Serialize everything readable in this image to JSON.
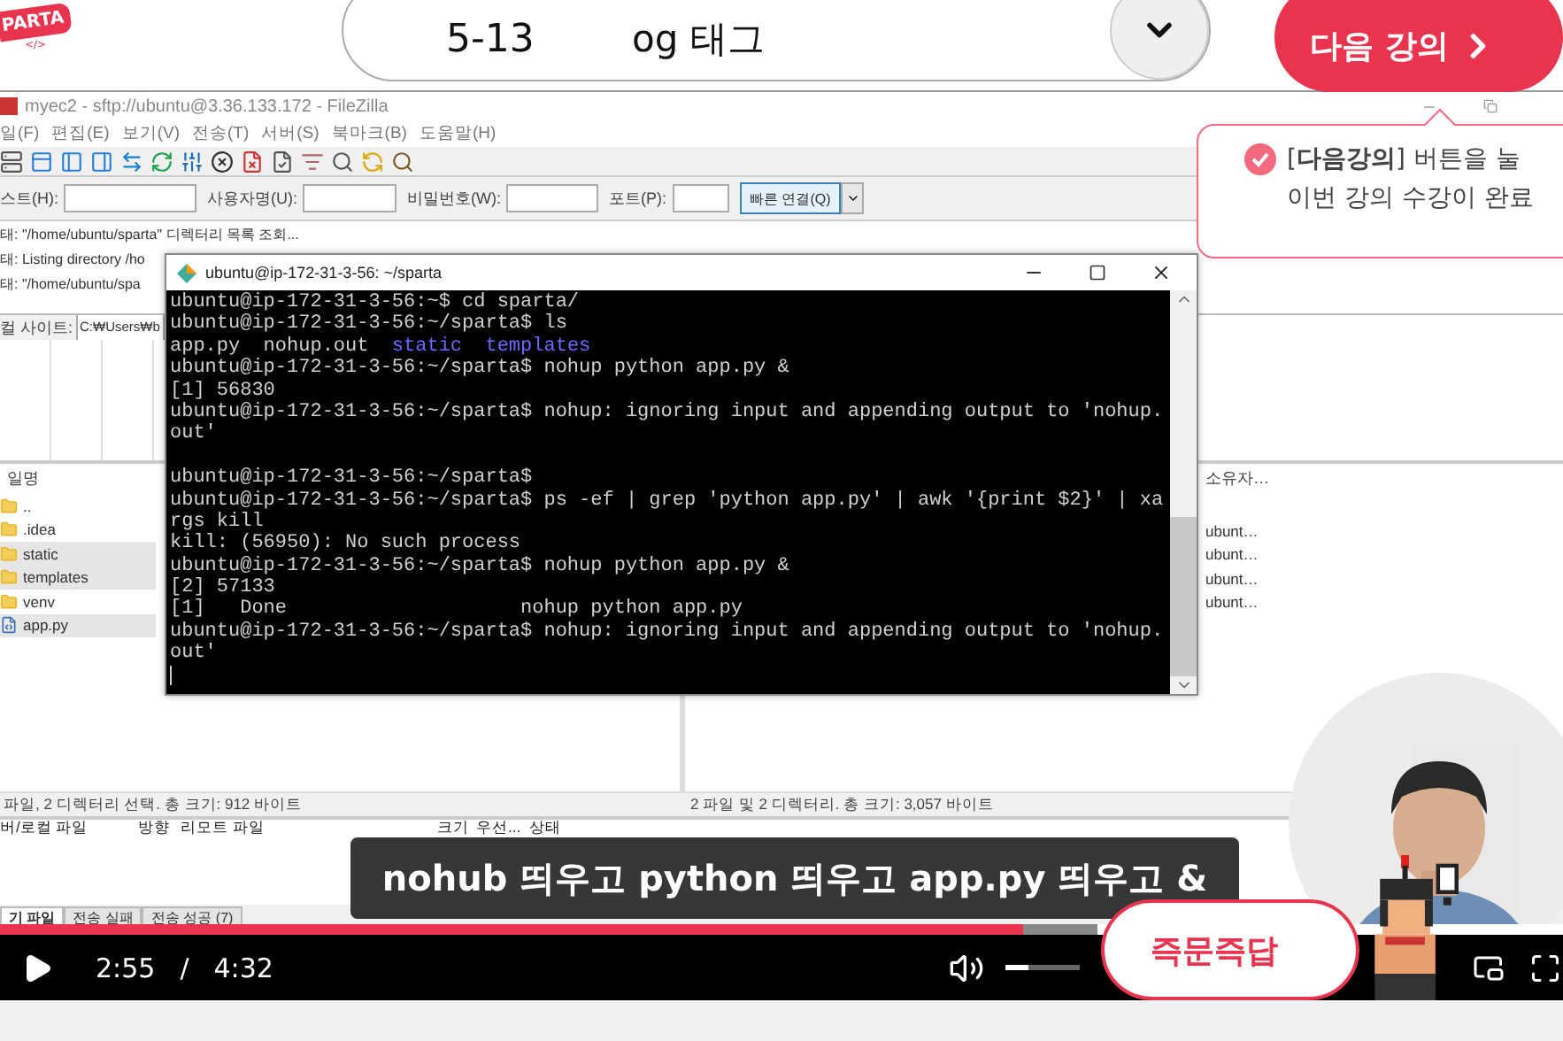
{
  "header": {
    "logo": {
      "text": "PARTA",
      "subtext": "</>"
    },
    "lesson": {
      "number": "5-13",
      "title": "og 태그"
    },
    "next_button": {
      "label": "다음 강의"
    }
  },
  "tooltip": {
    "lines": [
      "[**다음강의**] 버튼을 눌",
      "이번 강의 수강이 완료"
    ]
  },
  "filezilla": {
    "title": "myec2 - sftp://ubuntu@3.36.133.172 - FileZilla",
    "menu": [
      "일(F)",
      "편집(E)",
      "보기(V)",
      "전송(T)",
      "서버(S)",
      "북마크(B)",
      "도움말(H)"
    ],
    "quickconnect": {
      "fields": [
        {
          "label": "스트(H):"
        },
        {
          "label": "사용자명(U):"
        },
        {
          "label": "비밀번호(W):"
        },
        {
          "label": "포트(P):"
        }
      ],
      "button": "빠른 연결(Q)"
    },
    "log": [
      {
        "label": "태:",
        "text": "\"/home/ubuntu/sparta\" 디렉터리 목록 조회..."
      },
      {
        "label": "태:",
        "text": "Listing directory /ho"
      },
      {
        "label": "태:",
        "text": "\"/home/ubuntu/spa"
      }
    ],
    "local_site": {
      "label": "컬 사이트:",
      "value": "C:₩Users₩b"
    },
    "local_files": {
      "header": "일명",
      "rows": [
        {
          "name": "..",
          "kind": "folder",
          "selected": false
        },
        {
          "name": ".idea",
          "kind": "folder",
          "selected": false
        },
        {
          "name": "static",
          "kind": "folder",
          "selected": true
        },
        {
          "name": "templates",
          "kind": "folder",
          "selected": true
        },
        {
          "name": "venv",
          "kind": "folder",
          "selected": false
        },
        {
          "name": "app.py",
          "kind": "python",
          "selected": true
        }
      ]
    },
    "remote_files": {
      "column": "소유자…",
      "rows": [
        "ubunt…",
        "ubunt…",
        "ubunt…",
        "ubunt…"
      ]
    },
    "local_status": "파일, 2 디렉터리 선택. 총 크기: 912 바이트",
    "remote_status": "2 파일 및 2 디렉터리. 총 크기: 3,057 바이트",
    "queue": {
      "columns": [
        "버/로컬 파일",
        "방향",
        "리모트 파일",
        "크기",
        "우선...",
        "상태"
      ]
    },
    "queue_tabs": [
      {
        "label": "기 파일",
        "selected": true
      },
      {
        "label": "전송 실패",
        "selected": false
      },
      {
        "label": "전송 성공 (7)",
        "selected": false
      }
    ]
  },
  "terminal": {
    "title": "ubuntu@ip-172-31-3-56: ~/sparta",
    "lines": [
      {
        "kind": "text",
        "segments": [
          {
            "kind": "plain",
            "text": "ubuntu@ip-172-31-3-56:~$ cd sparta/"
          }
        ]
      },
      {
        "kind": "text",
        "segments": [
          {
            "kind": "plain",
            "text": "ubuntu@ip-172-31-3-56:~/sparta$ ls"
          }
        ]
      },
      {
        "kind": "text",
        "segments": [
          {
            "kind": "plain",
            "text": "app.py  nohup.out  "
          },
          {
            "kind": "dir",
            "text": "static  "
          },
          {
            "kind": "dir",
            "text": "templates"
          }
        ]
      },
      {
        "kind": "text",
        "segments": [
          {
            "kind": "plain",
            "text": "ubuntu@ip-172-31-3-56:~/sparta$ nohup python app.py &"
          }
        ]
      },
      {
        "kind": "text",
        "segments": [
          {
            "kind": "plain",
            "text": "[1] 56830"
          }
        ]
      },
      {
        "kind": "text",
        "segments": [
          {
            "kind": "plain",
            "text": "ubuntu@ip-172-31-3-56:~/sparta$ nohup: ignoring input and appending output to 'nohup."
          }
        ]
      },
      {
        "kind": "text",
        "segments": [
          {
            "kind": "plain",
            "text": "out'"
          }
        ]
      },
      {
        "kind": "blank"
      },
      {
        "kind": "text",
        "segments": [
          {
            "kind": "plain",
            "text": "ubuntu@ip-172-31-3-56:~/sparta$"
          }
        ]
      },
      {
        "kind": "text",
        "segments": [
          {
            "kind": "plain",
            "text": "ubuntu@ip-172-31-3-56:~/sparta$ ps -ef | grep 'python app.py' | awk '{print $2}' | xa"
          }
        ]
      },
      {
        "kind": "text",
        "segments": [
          {
            "kind": "plain",
            "text": "rgs kill"
          }
        ]
      },
      {
        "kind": "text",
        "segments": [
          {
            "kind": "plain",
            "text": "kill: (56950): No such process"
          }
        ]
      },
      {
        "kind": "text",
        "segments": [
          {
            "kind": "plain",
            "text": "ubuntu@ip-172-31-3-56:~/sparta$ nohup python app.py &"
          }
        ]
      },
      {
        "kind": "text",
        "segments": [
          {
            "kind": "plain",
            "text": "[2] 57133"
          }
        ]
      },
      {
        "kind": "text",
        "segments": [
          {
            "kind": "plain",
            "text": "[1]   Done                    nohup python app.py"
          }
        ]
      },
      {
        "kind": "text",
        "segments": [
          {
            "kind": "plain",
            "text": "ubuntu@ip-172-31-3-56:~/sparta$ nohup: ignoring input and appending output to 'nohup."
          }
        ]
      },
      {
        "kind": "text",
        "segments": [
          {
            "kind": "plain",
            "text": "out'"
          }
        ]
      }
    ]
  },
  "subtitle": "nohub 띄우고 python 띄우고 app.py 띄우고 &",
  "player": {
    "progress": {
      "level": 0.933
    },
    "current": "2:55",
    "separator": "/",
    "duration": "4:32",
    "volume": {
      "level": 0.3
    },
    "qa_badge": "즉문즉답"
  }
}
